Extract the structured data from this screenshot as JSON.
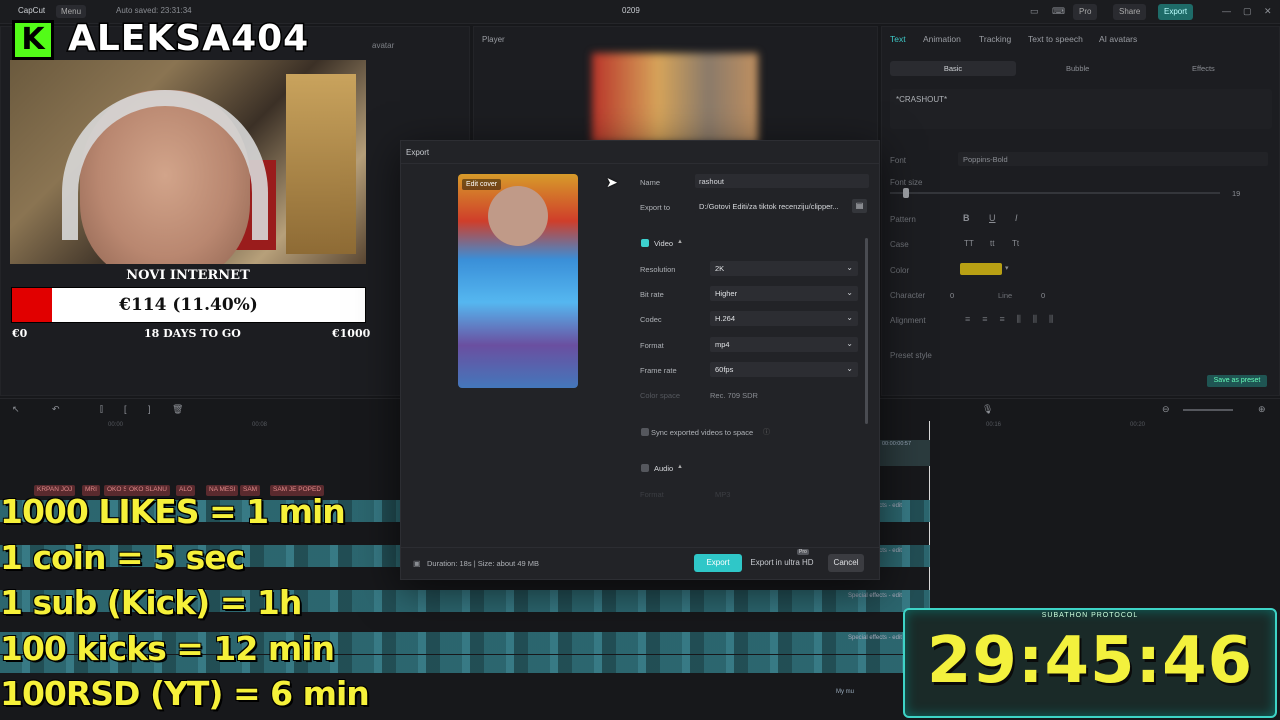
{
  "app": {
    "brand": "CapCut",
    "menu": "Menu",
    "autosave": "Auto saved: 23:31:34",
    "project": "0209",
    "pro": "Pro",
    "share": "Share",
    "export": "Export"
  },
  "player": {
    "title": "Player"
  },
  "media": {
    "avatar_label": "avatar"
  },
  "text_panel": {
    "tabs": [
      "Text",
      "Animation",
      "Tracking",
      "Text to speech",
      "AI avatars"
    ],
    "subtabs": [
      "Basic",
      "Bubble",
      "Effects"
    ],
    "content": "*CRASHOUT*",
    "font_label": "Font",
    "font_value": "Poppins-Bold",
    "font_size_label": "Font size",
    "font_size_value": "19",
    "pattern_label": "Pattern",
    "case_label": "Case",
    "color_label": "Color",
    "color_value": "#b8a014",
    "character_label": "Character",
    "character_value": "0",
    "line_label": "Line",
    "line_value": "0",
    "alignment_label": "Alignment",
    "preset_label": "Preset style",
    "save_preset": "Save as preset"
  },
  "export_dialog": {
    "title": "Export",
    "edit_cover": "Edit cover",
    "name_label": "Name",
    "name_value": "rashout",
    "export_to_label": "Export to",
    "export_to_value": "D:/Gotovi Editi/za tiktok recenziju/clipper...",
    "video_label": "Video",
    "resolution_label": "Resolution",
    "resolution_value": "2K",
    "bitrate_label": "Bit rate",
    "bitrate_value": "Higher",
    "codec_label": "Codec",
    "codec_value": "H.264",
    "format_label": "Format",
    "format_value": "mp4",
    "framerate_label": "Frame rate",
    "framerate_value": "60fps",
    "colorspace_label": "Color space",
    "colorspace_value": "Rec. 709 SDR",
    "sync_label": "Sync exported videos to space",
    "audio_label": "Audio",
    "audio_format_label": "Format",
    "audio_format_value": "MP3",
    "duration_info": "Duration: 18s | Size: about 49 MB",
    "export_button": "Export",
    "export_uhd_button": "Export in ultra HD",
    "cancel_button": "Cancel",
    "pro_badge": "Pro"
  },
  "timeline": {
    "times": [
      "00:00",
      "00:08",
      "00:16",
      "00:20"
    ],
    "clip_time": "00:00:00:57",
    "text_clips": [
      "KRPAN JOJ",
      "MRI",
      "OKO S",
      "OKO SLANU",
      "ALO",
      "NA MESI",
      "SAM",
      "SAM JE POPED"
    ],
    "effects_labels": [
      "Special effects - edit",
      "Special effects - edit",
      "Special effects - edit",
      "Special effects - edit"
    ],
    "music_label": "My mu"
  },
  "overlay": {
    "streamer_name": "ALEKSA404",
    "kick_letter": "K",
    "goal_title": "NOVI INTERNET",
    "goal_value": "€114 (11.40%)",
    "goal_fraction": 0.114,
    "goal_min": "€0",
    "goal_days": "18 DAYS TO GO",
    "goal_max": "€1000",
    "rules": [
      "1000 LIKES = 1 min",
      "1 coin = 5 sec",
      "1 sub (Kick) = 1h",
      "100 kicks = 12 min",
      "100RSD (YT) = 6 min"
    ],
    "subathon_label": "SUBATHON PROTOCOL",
    "timer": "29:45:46"
  }
}
